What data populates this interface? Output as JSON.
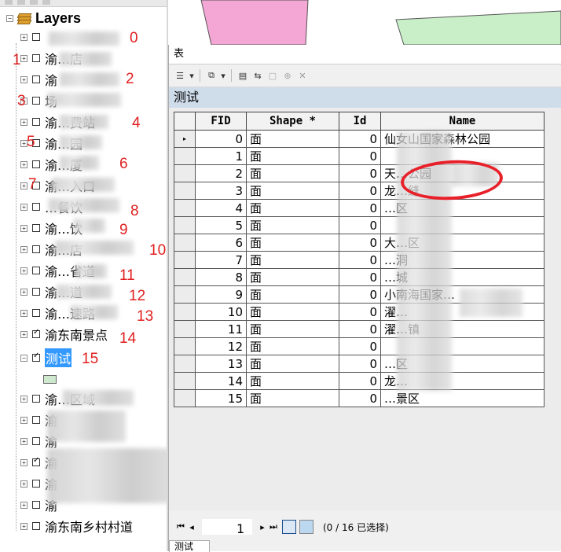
{
  "toc": {
    "root_title": "Layers",
    "layers": [
      {
        "label": "",
        "num": "0",
        "checked": false
      },
      {
        "label": "渝…店",
        "num": "1",
        "checked": false
      },
      {
        "label": "渝",
        "num": "2",
        "checked": false
      },
      {
        "label": "场",
        "num": "3",
        "checked": false
      },
      {
        "label": "渝…费站",
        "num": "4",
        "checked": false
      },
      {
        "label": "渝…园",
        "num": "5",
        "checked": false
      },
      {
        "label": "渝…厦",
        "num": "6",
        "checked": false
      },
      {
        "label": "渝…入口",
        "num": "7",
        "checked": false
      },
      {
        "label": "…餐饮",
        "num": "8",
        "checked": false
      },
      {
        "label": "渝…饮",
        "num": "9",
        "checked": false
      },
      {
        "label": "渝…店",
        "num": "10",
        "checked": false
      },
      {
        "label": "渝…省道",
        "num": "11",
        "checked": false
      },
      {
        "label": "渝…道",
        "num": "12",
        "checked": false
      },
      {
        "label": "渝…速路",
        "num": "13",
        "checked": false
      },
      {
        "label": "渝东南景点",
        "num": "14",
        "checked": true
      },
      {
        "label": "测试",
        "num": "15",
        "checked": true,
        "selected": true,
        "expanded": true
      },
      {
        "label": "渝…区域",
        "num": "",
        "checked": false
      },
      {
        "label": "渝",
        "num": "",
        "checked": false
      },
      {
        "label": "渝",
        "num": "",
        "checked": false
      },
      {
        "label": "渝",
        "num": "",
        "checked": true
      },
      {
        "label": "渝",
        "num": "",
        "checked": false
      },
      {
        "label": "渝",
        "num": "",
        "checked": false
      },
      {
        "label": "渝东南乡村村道",
        "num": "",
        "checked": false
      }
    ]
  },
  "window": {
    "title": "表",
    "table_name": "测试",
    "columns": [
      "FID",
      "Shape *",
      "Id",
      "Name"
    ],
    "rows": [
      {
        "fid": "0",
        "shape": "面",
        "id": "0",
        "name": "仙女山国家森林公园"
      },
      {
        "fid": "1",
        "shape": "面",
        "id": "0",
        "name": ""
      },
      {
        "fid": "2",
        "shape": "面",
        "id": "0",
        "name": "天…公园"
      },
      {
        "fid": "3",
        "shape": "面",
        "id": "0",
        "name": "龙…缝"
      },
      {
        "fid": "4",
        "shape": "面",
        "id": "0",
        "name": "…区"
      },
      {
        "fid": "5",
        "shape": "面",
        "id": "0",
        "name": ""
      },
      {
        "fid": "6",
        "shape": "面",
        "id": "0",
        "name": "大…区"
      },
      {
        "fid": "7",
        "shape": "面",
        "id": "0",
        "name": "…洞"
      },
      {
        "fid": "8",
        "shape": "面",
        "id": "0",
        "name": "…城"
      },
      {
        "fid": "9",
        "shape": "面",
        "id": "0",
        "name": "小南海国家…"
      },
      {
        "fid": "10",
        "shape": "面",
        "id": "0",
        "name": "濯…"
      },
      {
        "fid": "11",
        "shape": "面",
        "id": "0",
        "name": "濯…镇"
      },
      {
        "fid": "12",
        "shape": "面",
        "id": "0",
        "name": ""
      },
      {
        "fid": "13",
        "shape": "面",
        "id": "0",
        "name": "…区"
      },
      {
        "fid": "14",
        "shape": "面",
        "id": "0",
        "name": "龙…"
      },
      {
        "fid": "15",
        "shape": "面",
        "id": "0",
        "name": "…景区"
      }
    ],
    "nav": {
      "page": "1",
      "selection": "(0 / 16 已选择)"
    },
    "bottom_tab": "测试"
  },
  "colors": {
    "highlight": "#3399ff",
    "annotation": "#e02020",
    "circle": "#e8202a",
    "tablebar": "#cfdcea",
    "map_pink": "#f4a6d4",
    "map_green": "#c9efc9"
  }
}
